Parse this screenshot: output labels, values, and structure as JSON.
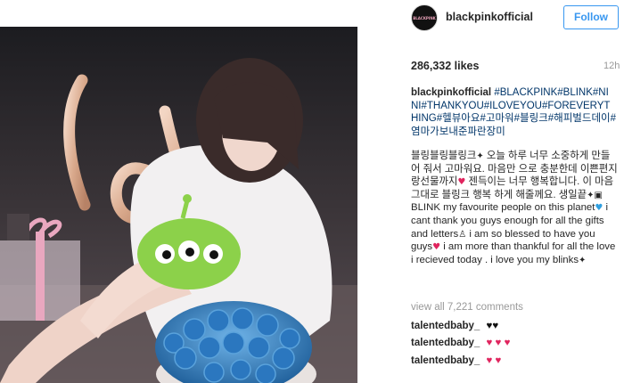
{
  "account": {
    "username": "blackpinkofficial",
    "avatar_text": "BLACKPINK",
    "follow_label": "Follow"
  },
  "post": {
    "likes": "286,332 likes",
    "time": "12h",
    "caption_user": "blackpinkofficial",
    "caption_tags": "#BLACKPINK#BLINK#NINI#THANKYOU#ILOVEYOU#FOREVERYTHING#헬뷰아요#고마워#블링크#해피벌드데이#염마가보내준파란장미",
    "caption_line1": "블링블링블링크",
    "caption_line2": " 오늘 하루 너무 소중하게 만들어 줘서 고마워요. 마음만 으로 충분한데 이쁜편지랑선물까지",
    "caption_line3": "젠득이는 너무 행복합니다. 이 마음 그대로 블링크 행복 하게 해줄께요. 생일끝",
    "caption_line4": " BLINK my favourite people on this planet",
    "caption_line5": " i cant thank you guys enough for all the gifts and letters",
    "caption_line6": " i am so blessed to have you guys",
    "caption_line7": " i am more than thankful for all the love i recieved today . i love you my blinks",
    "view_all": "view all 7,221 comments",
    "photo_alt": "lov"
  },
  "comments": [
    {
      "user": "talentedbaby_",
      "hearts": "♥♥"
    },
    {
      "user": "talentedbaby_",
      "hearts": "♥ ♥ ♥"
    },
    {
      "user": "talentedbaby_",
      "hearts": "♥ ♥"
    }
  ],
  "colors": {
    "link_blue": "#3897f0",
    "tag_blue": "#003569",
    "muted": "#999999",
    "heart_red": "#e0245e",
    "heart_blue": "#2f9fe0"
  },
  "icons": {
    "sparkle": "✦",
    "heart": "♥",
    "gift": "▣",
    "person": "♙"
  }
}
